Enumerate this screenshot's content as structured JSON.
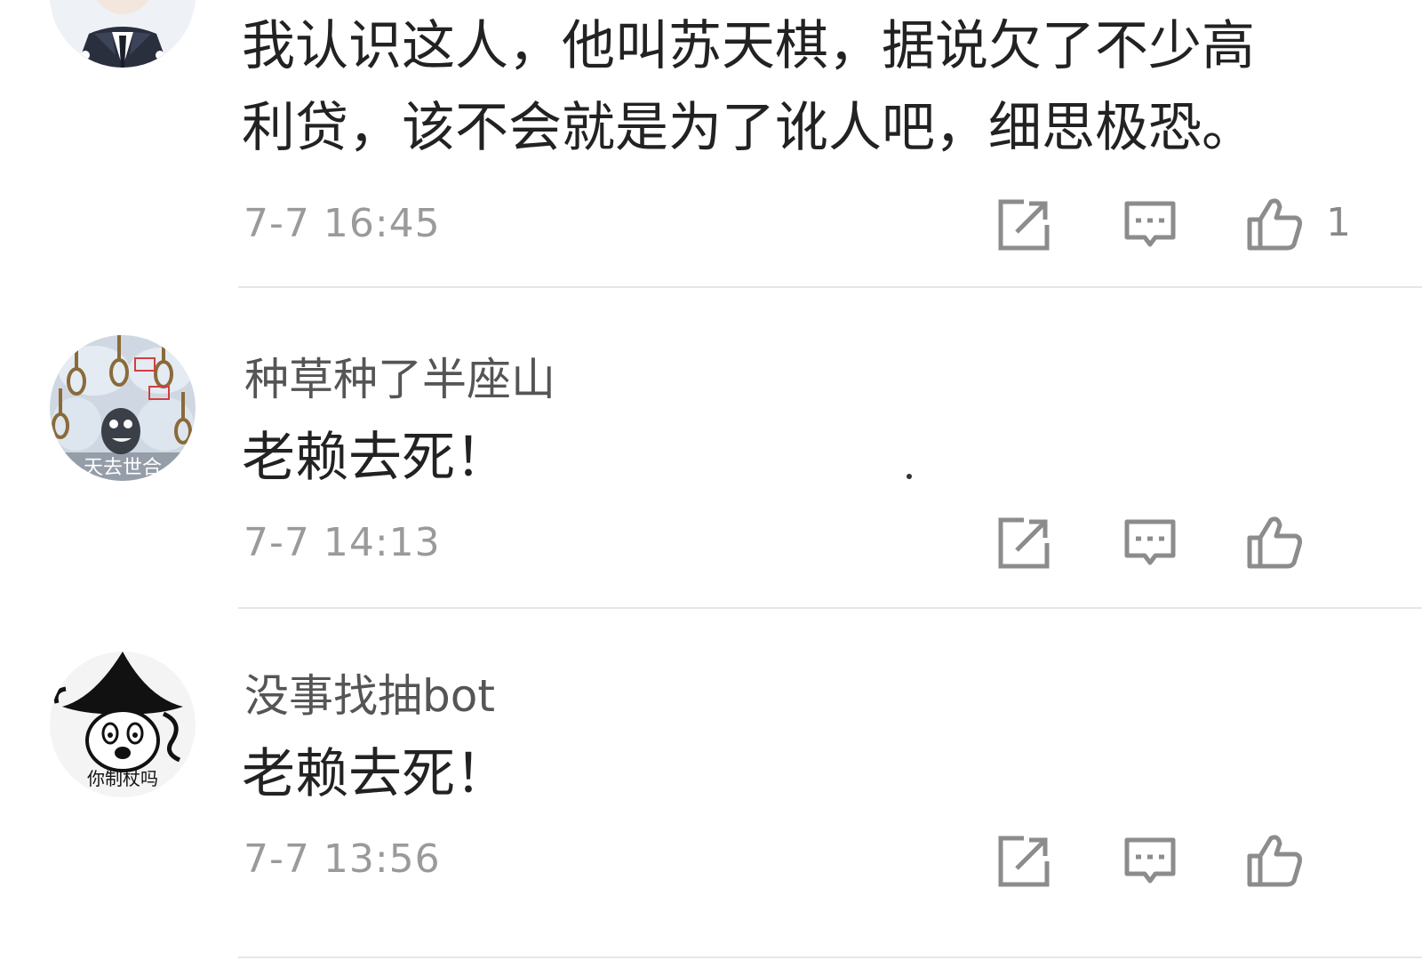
{
  "comments": [
    {
      "username": "",
      "text_lines": [
        "我认识这人，他叫苏天棋，据说欠了不少高",
        "利贷，该不会就是为了讹人吧，细思极恐。"
      ],
      "time": "7-7 16:45",
      "like_count": "1",
      "avatar_icon": "cartoon-suit-avatar"
    },
    {
      "username": "种草种了半座山",
      "text_lines": [
        "老赖去死！"
      ],
      "time": "7-7 14:13",
      "like_count": "",
      "avatar_icon": "cat-noose-meme-avatar",
      "avatar_caption": "天去世合"
    },
    {
      "username": "没事找抽bot",
      "text_lines": [
        "老赖去死！"
      ],
      "time": "7-7 13:56",
      "like_count": "",
      "avatar_icon": "wizard-meme-avatar",
      "avatar_caption": "你制杖吗"
    }
  ],
  "icons": {
    "share": "share-icon",
    "reply": "reply-icon",
    "like": "like-icon"
  },
  "colors": {
    "text": "#222222",
    "username": "#555555",
    "time": "#9a9a9a",
    "icon": "#8c8c8c",
    "divider": "#e6e6e6"
  }
}
